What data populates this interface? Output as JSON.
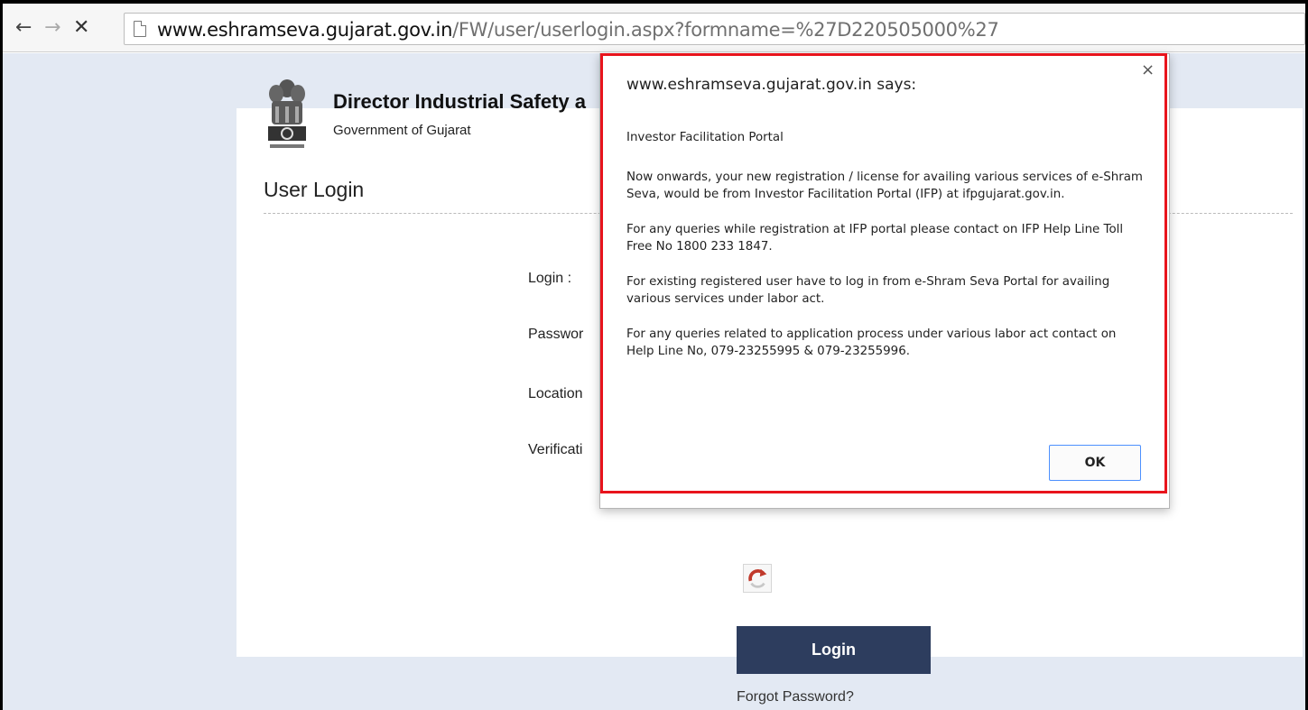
{
  "browser": {
    "back_icon": "←",
    "forward_icon": "→",
    "stop_icon": "✕",
    "url_host": "www.eshramseva.gujarat.gov.in",
    "url_path": "/FW/user/userlogin.aspx?formname=%27D220505000%27"
  },
  "header": {
    "title": "Director Industrial Safety a",
    "subtitle": "Government of Gujarat"
  },
  "login_page": {
    "title": "User Login",
    "labels": {
      "login": "Login :",
      "password": "Passwor",
      "location": "Location",
      "verification": "Verificati"
    },
    "login_button": "Login",
    "forgot_password": "Forgot Password?"
  },
  "dialog": {
    "title": "www.eshramseva.gujarat.gov.in says:",
    "close_icon": "×",
    "paragraphs": [
      "Investor Facilitation Portal",
      "Now onwards, your new registration / license for availing various services of e-Shram Seva, would be from Investor Facilitation Portal (IFP) at ifpgujarat.gov.in.",
      "For any queries while registration at IFP portal please contact on IFP Help Line Toll Free No 1800 233 1847.",
      "For existing registered user have to log in from e-Shram Seva Portal for availing various services under labor act.",
      "For any queries related to application process under various labor act contact on Help Line No, 079-23255995 & 079-23255996."
    ],
    "ok_label": "OK"
  },
  "colors": {
    "page_background": "#e3e9f3",
    "login_button": "#2d3d5e",
    "highlight_border": "#e8141c"
  }
}
